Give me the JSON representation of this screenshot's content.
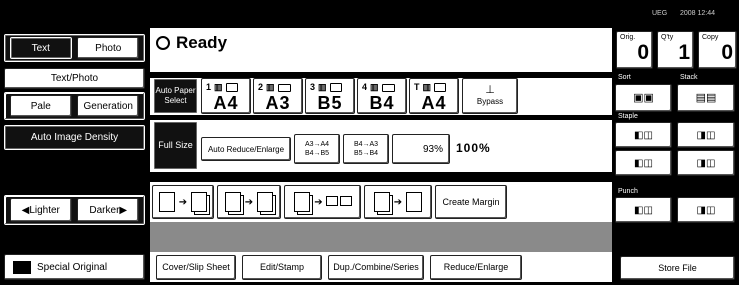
{
  "status": {
    "text": "Ready",
    "indicator": "ready-circle-icon"
  },
  "top_bar": {
    "user_code": "UEG",
    "datetime": "2008 12:44"
  },
  "counters": [
    {
      "id": "orig",
      "label": "Orig.",
      "value": "0"
    },
    {
      "id": "qty",
      "label": "Q'ty",
      "value": "1"
    },
    {
      "id": "copy",
      "label": "Copy",
      "value": "0"
    }
  ],
  "original_type": {
    "text": "Text",
    "photo": "Photo",
    "text_photo": "Text/Photo",
    "pale": "Pale",
    "generation": "Generation"
  },
  "density": {
    "auto": "Auto Image Density",
    "lighter": "Lighter",
    "darker": "Darker"
  },
  "special_original": "Special Original",
  "paper": {
    "auto_select": "Auto Paper Select",
    "trays": [
      {
        "num": "1",
        "size": "A4"
      },
      {
        "num": "2",
        "size": "A3"
      },
      {
        "num": "3",
        "size": "B5"
      },
      {
        "num": "4",
        "size": "B4"
      },
      {
        "num": "T",
        "size": "A4"
      }
    ],
    "bypass": "Bypass"
  },
  "reduce": {
    "full_size": "Full Size",
    "auto_reduce": "Auto Reduce/Enlarge",
    "preset1_top": "A3→A4",
    "preset1_bottom": "B4→B5",
    "preset2_top": "B4→A3",
    "preset2_bottom": "B5→B4",
    "ratio": "93%",
    "current_ratio": "100%"
  },
  "create_margin": "Create Margin",
  "tabs": [
    "Cover/Slip Sheet",
    "Edit/Stamp",
    "Dup./Combine/Series",
    "Reduce/Enlarge"
  ],
  "right_panel": {
    "sort": "Sort",
    "stack": "Stack",
    "staple": "Staple",
    "punch": "Punch",
    "store_file": "Store File"
  }
}
